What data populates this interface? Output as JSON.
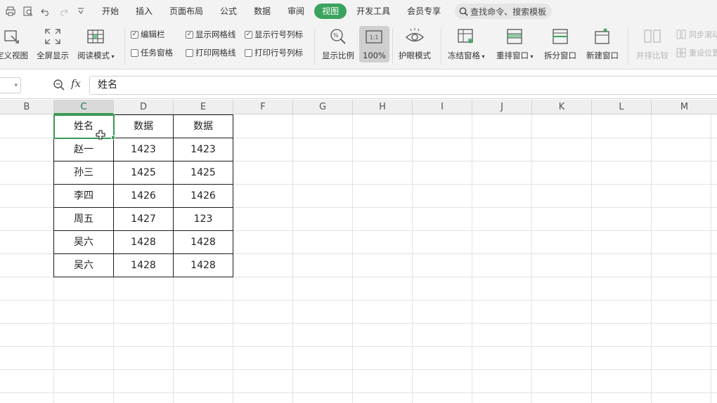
{
  "quick_access": {
    "icons": [
      "print-icon",
      "print-preview-icon",
      "undo-icon",
      "redo-icon",
      "customize-icon"
    ]
  },
  "menu": {
    "tabs": [
      {
        "label": "开始",
        "active": false
      },
      {
        "label": "插入",
        "active": false
      },
      {
        "label": "页面布局",
        "active": false
      },
      {
        "label": "公式",
        "active": false
      },
      {
        "label": "数据",
        "active": false
      },
      {
        "label": "审阅",
        "active": false
      },
      {
        "label": "视图",
        "active": true
      },
      {
        "label": "开发工具",
        "active": false
      },
      {
        "label": "会员专享",
        "active": false
      }
    ],
    "search_placeholder": "查找命令、搜索模板"
  },
  "ribbon": {
    "custom_view": "定义视图",
    "full_screen": "全屏显示",
    "reading_mode": "阅读模式",
    "checks": {
      "edit_bar": {
        "label": "编辑栏",
        "checked": true
      },
      "task_pane": {
        "label": "任务窗格",
        "checked": false
      },
      "show_gridlines": {
        "label": "显示网格线",
        "checked": true
      },
      "print_gridlines": {
        "label": "打印网格线",
        "checked": false
      },
      "show_headings": {
        "label": "显示行号列标",
        "checked": true
      },
      "print_headings": {
        "label": "打印行号列标",
        "checked": false
      }
    },
    "zoom": "显示比例",
    "zoom_100": "100%",
    "zoom_100_icon_text": "1:1",
    "eye_protection": "护眼模式",
    "freeze_panes": "冻结窗格",
    "rearrange": "重排窗口",
    "split": "拆分窗口",
    "new_window": "新建窗口",
    "side_by_side": "并排比较",
    "sync_scroll": "同步滚动",
    "reset_position": "重设位置"
  },
  "formula_bar": {
    "fx": "fx",
    "content": "姓名"
  },
  "columns": [
    "B",
    "C",
    "D",
    "E",
    "F",
    "G",
    "H",
    "I",
    "J",
    "K",
    "L",
    "M"
  ],
  "selected_column": "C",
  "table": {
    "header": [
      "姓名",
      "数据",
      "数据"
    ],
    "rows": [
      [
        "赵一",
        "1423",
        "1423"
      ],
      [
        "孙三",
        "1425",
        "1425"
      ],
      [
        "李四",
        "1426",
        "1426"
      ],
      [
        "周五",
        "1427",
        "123"
      ],
      [
        "吴六",
        "1428",
        "1428"
      ],
      [
        "吴六",
        "1428",
        "1428"
      ]
    ]
  },
  "colors": {
    "accent": "#3aa35e",
    "selection": "#3a9a56"
  }
}
